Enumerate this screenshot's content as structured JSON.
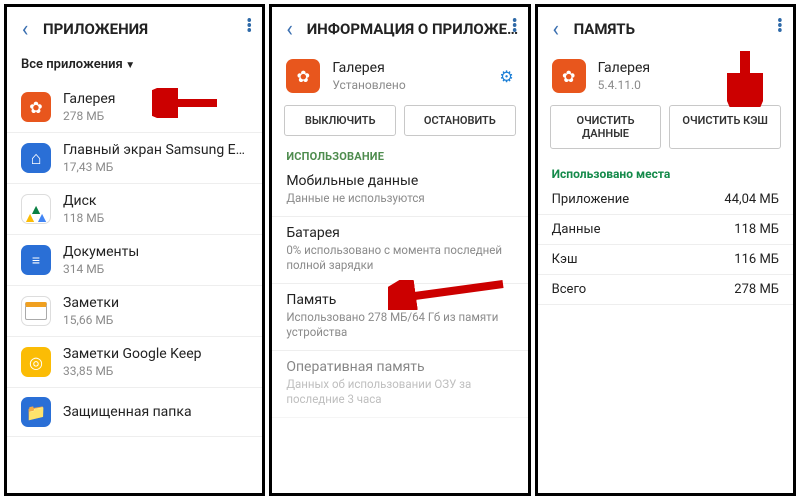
{
  "panel1": {
    "title": "ПРИЛОЖЕНИЯ",
    "filter": "Все приложения",
    "items": [
      {
        "name": "Галерея",
        "sub": "278 МБ",
        "icon": "gallery"
      },
      {
        "name": "Главный экран Samsung Experie..",
        "sub": "17,43 МБ",
        "icon": "home"
      },
      {
        "name": "Диск",
        "sub": "118 МБ",
        "icon": "drive"
      },
      {
        "name": "Документы",
        "sub": "314 МБ",
        "icon": "docs"
      },
      {
        "name": "Заметки",
        "sub": "15,66 МБ",
        "icon": "notes"
      },
      {
        "name": "Заметки Google Keep",
        "sub": "33,85 МБ",
        "icon": "keep"
      },
      {
        "name": "Защищенная папка",
        "sub": "",
        "icon": "secure"
      }
    ]
  },
  "panel2": {
    "title": "ИНФОРМАЦИЯ О ПРИЛОЖЕНИИ",
    "app_name": "Галерея",
    "app_status": "Установлено",
    "btn_disable": "ВЫКЛЮЧИТЬ",
    "btn_stop": "ОСТАНОВИТЬ",
    "section_usage": "ИСПОЛЬЗОВАНИЕ",
    "rows": [
      {
        "name": "Мобильные данные",
        "sub": "Данные не используются"
      },
      {
        "name": "Батарея",
        "sub": "0% использовано с момента последней полной зарядки"
      },
      {
        "name": "Память",
        "sub": "Использовано 278 МБ/64 Гб из памяти устройства"
      },
      {
        "name": "Оперативная память",
        "sub": "Данных об использовании ОЗУ за последние 3 часа"
      }
    ]
  },
  "panel3": {
    "title": "ПАМЯТЬ",
    "app_name": "Галерея",
    "app_version": "5.4.11.0",
    "btn_clear_data": "ОЧИСТИТЬ ДАННЫЕ",
    "btn_clear_cache": "ОЧИСТИТЬ КЭШ",
    "section_used": "Использовано места",
    "rows": [
      {
        "k": "Приложение",
        "v": "44,04 МБ"
      },
      {
        "k": "Данные",
        "v": "118 МБ"
      },
      {
        "k": "Кэш",
        "v": "116 МБ"
      },
      {
        "k": "Всего",
        "v": "278 МБ"
      }
    ]
  }
}
